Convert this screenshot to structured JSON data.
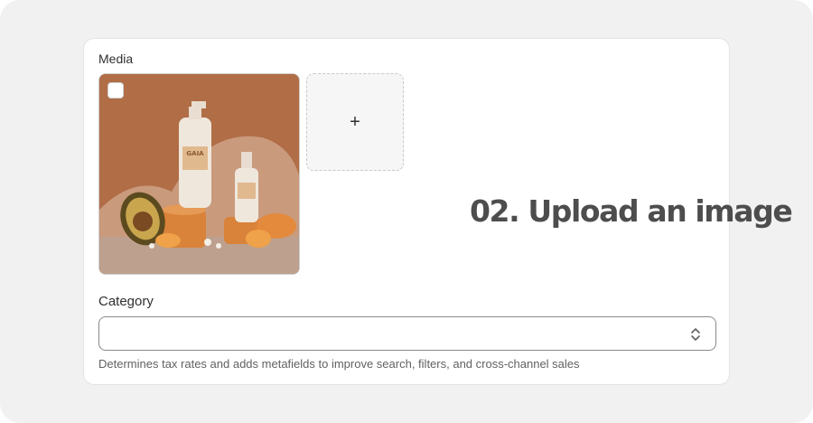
{
  "media": {
    "label": "Media",
    "thumbnail": {
      "alt_colors": {
        "background": "#b06d46",
        "bottle": "#efe7dc",
        "fruit": "#e38a3c"
      },
      "bottle_brand_text": "GAIA"
    },
    "add_button_label": "+"
  },
  "overlay": {
    "step_text": "02. Upload an image"
  },
  "category": {
    "label": "Category",
    "value": "",
    "help_text": "Determines tax rates and adds metafields to improve search, filters, and cross-channel sales"
  },
  "colors": {
    "frame_bg": "#f1f1f1",
    "card_bg": "#ffffff",
    "step_text": "#4d4d4d"
  }
}
